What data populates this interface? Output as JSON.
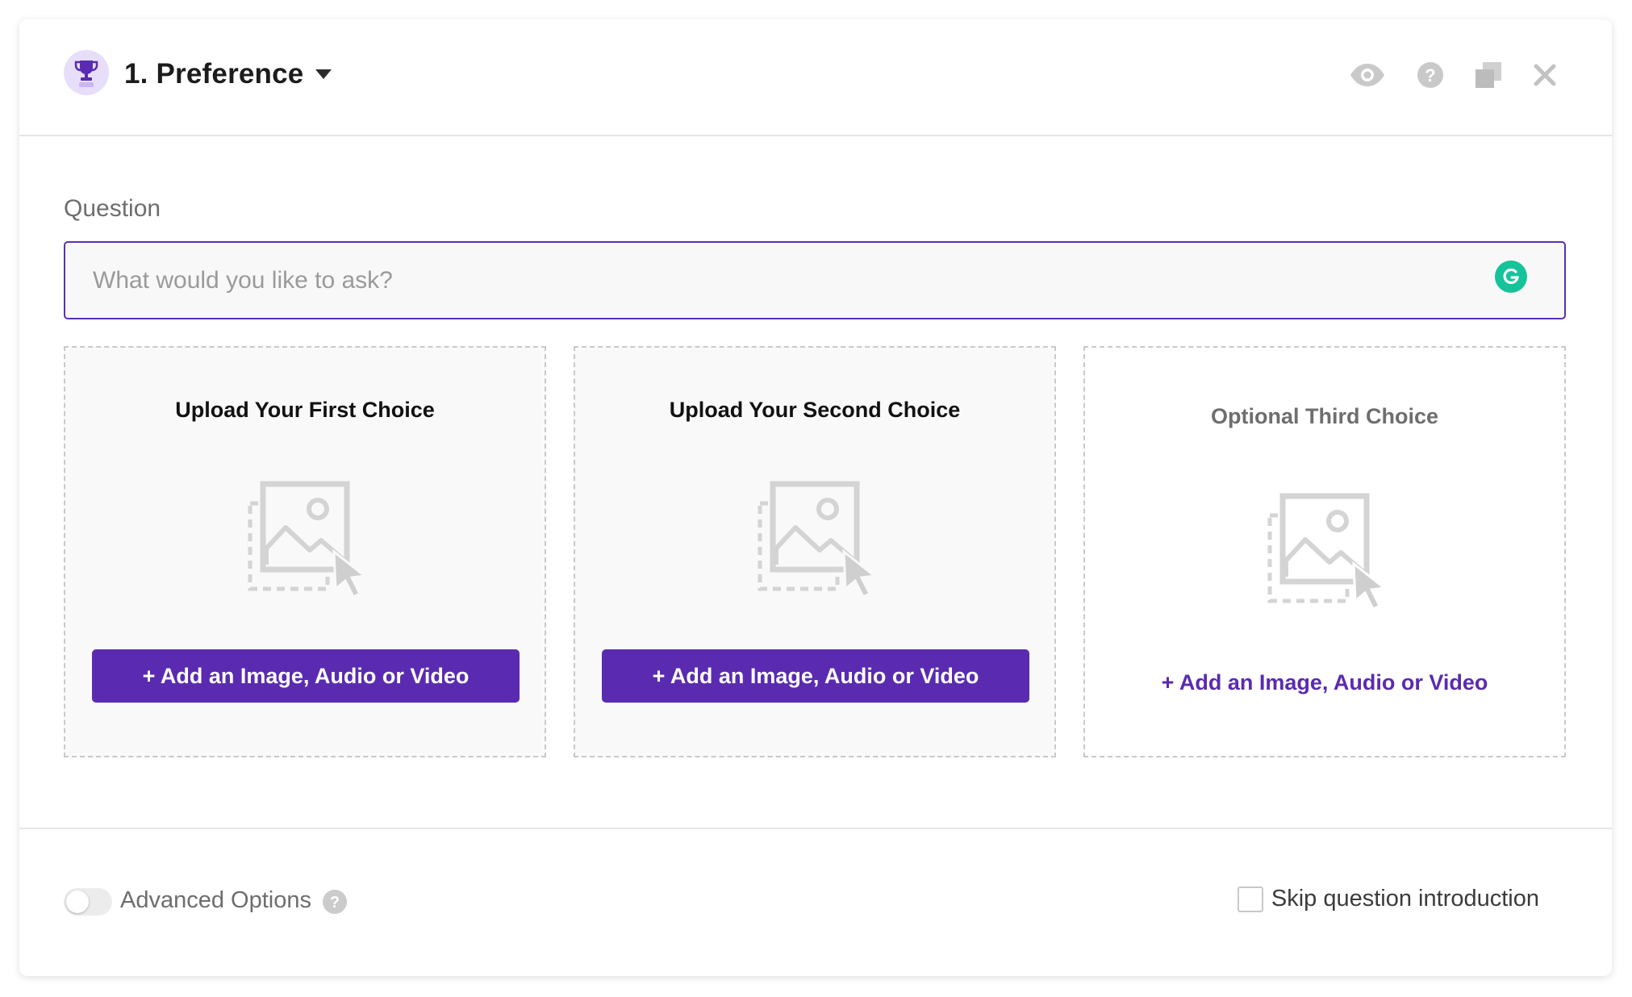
{
  "header": {
    "title": "1. Preference",
    "badge_icon": "trophy-icon",
    "actions": [
      "eye-icon",
      "help-icon",
      "duplicate-icon",
      "close-icon"
    ]
  },
  "question": {
    "label": "Question",
    "placeholder": "What would you like to ask?",
    "value": ""
  },
  "choices": [
    {
      "title": "Upload Your First Choice",
      "action": "+ Add an Image, Audio or Video",
      "style": "button"
    },
    {
      "title": "Upload Your Second Choice",
      "action": "+ Add an Image, Audio or Video",
      "style": "button"
    },
    {
      "title": "Optional Third Choice",
      "action": "+ Add an Image, Audio or Video",
      "style": "link"
    }
  ],
  "footer": {
    "advanced_label": "Advanced Options",
    "advanced_enabled": false,
    "skip_label": "Skip question introduction",
    "skip_checked": false
  },
  "colors": {
    "accent": "#5a2bb0",
    "badge_bg": "#e7defa",
    "grammarly": "#15c39a",
    "muted": "#6d6d6d"
  }
}
